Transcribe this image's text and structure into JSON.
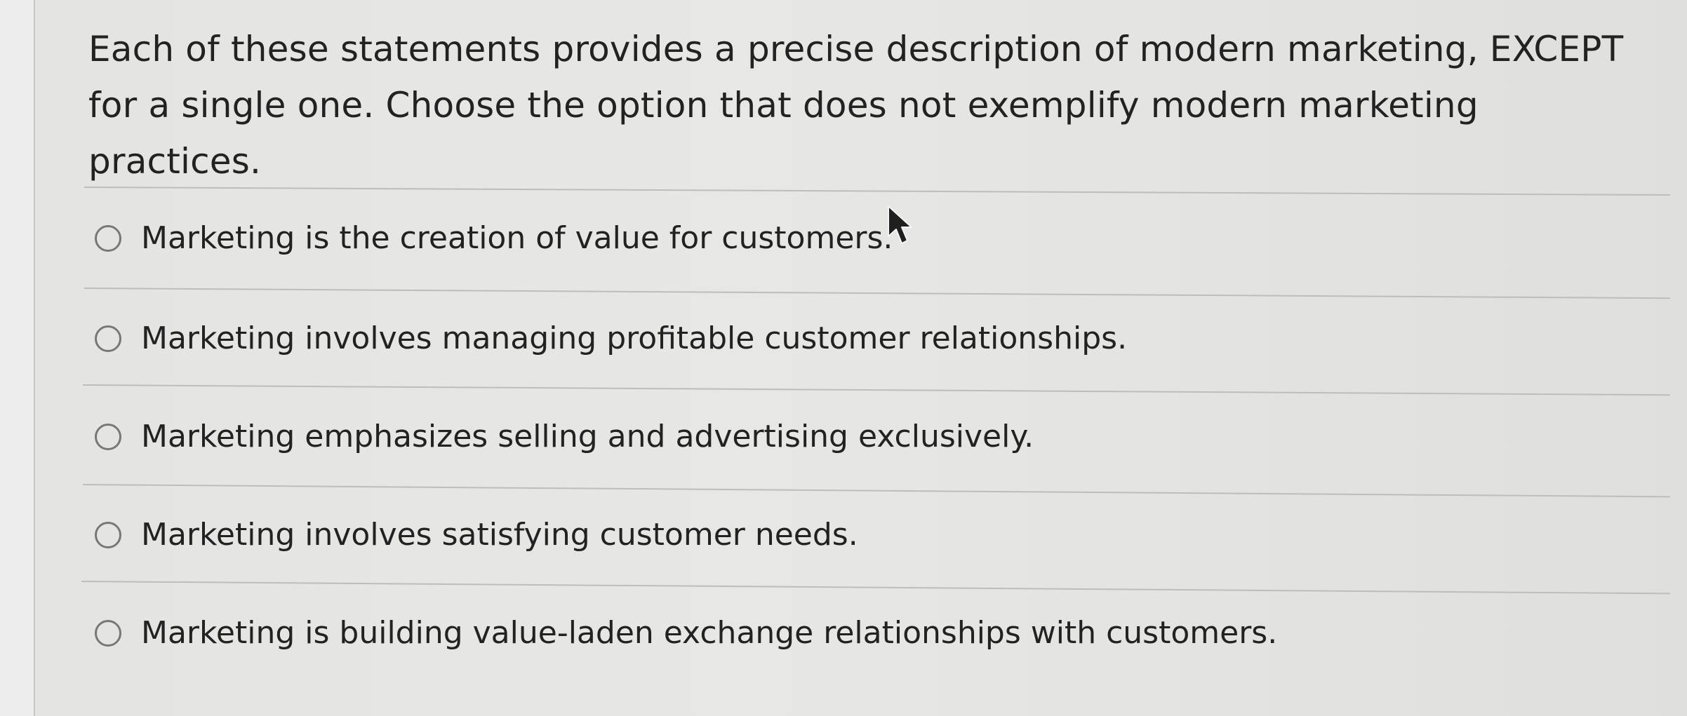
{
  "question": {
    "text": "Each of these statements provides a precise description of modern marketing, EXCEPT for a single one. Choose the option that does not exemplify modern marketing practices."
  },
  "options": [
    "Marketing is the creation of value for customers.",
    "Marketing involves managing profitable customer relationships.",
    "Marketing emphasizes selling and advertising exclusively.",
    "Marketing involves satisfying customer needs.",
    "Marketing is building value-laden exchange relationships with customers."
  ],
  "icons": {
    "radio": "radio-button-icon",
    "cursor": "mouse-pointer-icon"
  },
  "colors": {
    "background": "#e5e5e3",
    "text": "#222222",
    "divider": "#bdbdbb"
  }
}
